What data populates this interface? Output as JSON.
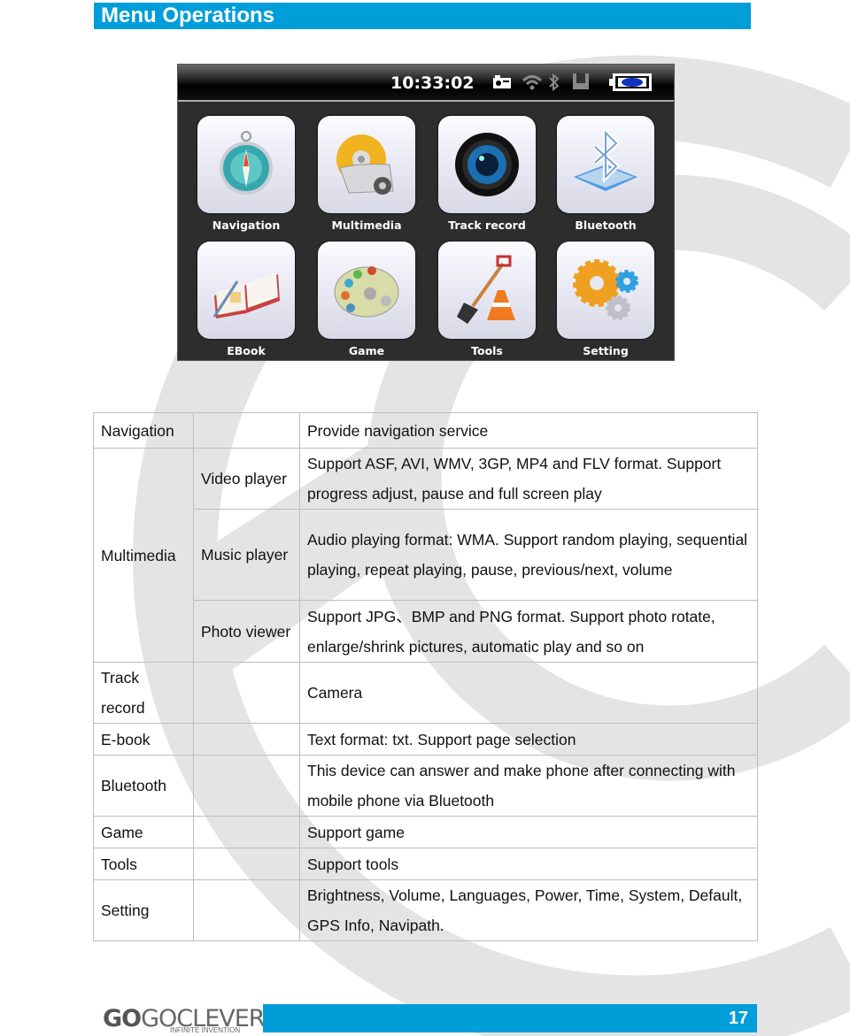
{
  "header": {
    "title": "Menu Operations"
  },
  "device_screen": {
    "clock": "10:33:02",
    "status_icons": [
      "camera-icon",
      "wifi-icon",
      "bluetooth-icon",
      "storage-icon",
      "battery-charging-icon"
    ],
    "menu_items": [
      {
        "label": "Navigation",
        "icon": "compass-icon"
      },
      {
        "label": "Multimedia",
        "icon": "multimedia-disc-icon"
      },
      {
        "label": "Track record",
        "icon": "camera-lens-icon"
      },
      {
        "label": "Bluetooth",
        "icon": "bluetooth-icon"
      },
      {
        "label": "EBook",
        "icon": "book-icon"
      },
      {
        "label": "Game",
        "icon": "palette-icon"
      },
      {
        "label": "Tools",
        "icon": "shovel-cone-icon"
      },
      {
        "label": "Setting",
        "icon": "gears-icon"
      }
    ]
  },
  "table": {
    "rows": [
      {
        "menu": "Navigation",
        "sub": "",
        "description": "Provide navigation service"
      },
      {
        "menu": "Multimedia",
        "sub": "Video player",
        "description": "Support ASF, AVI, WMV, 3GP, MP4 and FLV format. Support progress adjust, pause and full screen play"
      },
      {
        "menu": "",
        "sub": "Music player",
        "description": "Audio playing format: WMA. Support random playing, sequential playing, repeat playing, pause, previous/next, volume"
      },
      {
        "menu": "",
        "sub": "Photo viewer",
        "description": "Support JPG、BMP and PNG format. Support photo rotate, enlarge/shrink pictures, automatic play and so on"
      },
      {
        "menu": "Track record",
        "sub": "",
        "description": "Camera"
      },
      {
        "menu": "E-book",
        "sub": "",
        "description": "Text format: txt. Support page selection"
      },
      {
        "menu": "Bluetooth",
        "sub": "",
        "description": "This device can answer and make phone after connecting with mobile phone via Bluetooth"
      },
      {
        "menu": "Game",
        "sub": "",
        "description": "Support game"
      },
      {
        "menu": "Tools",
        "sub": "",
        "description": "Support tools"
      },
      {
        "menu": "Setting",
        "sub": "",
        "description": "Brightness, Volume, Languages, Power, Time, System, Default, GPS Info, Navipath."
      }
    ]
  },
  "footer": {
    "logo_mark": "GO",
    "logo_name": "GOCLEVER",
    "logo_tagline": "INFINITE INVENTION",
    "page_number": "17"
  },
  "colors": {
    "accent": "#009ed8",
    "screen_bg": "#2d2d2d",
    "watermark": "#e0e0e0"
  }
}
